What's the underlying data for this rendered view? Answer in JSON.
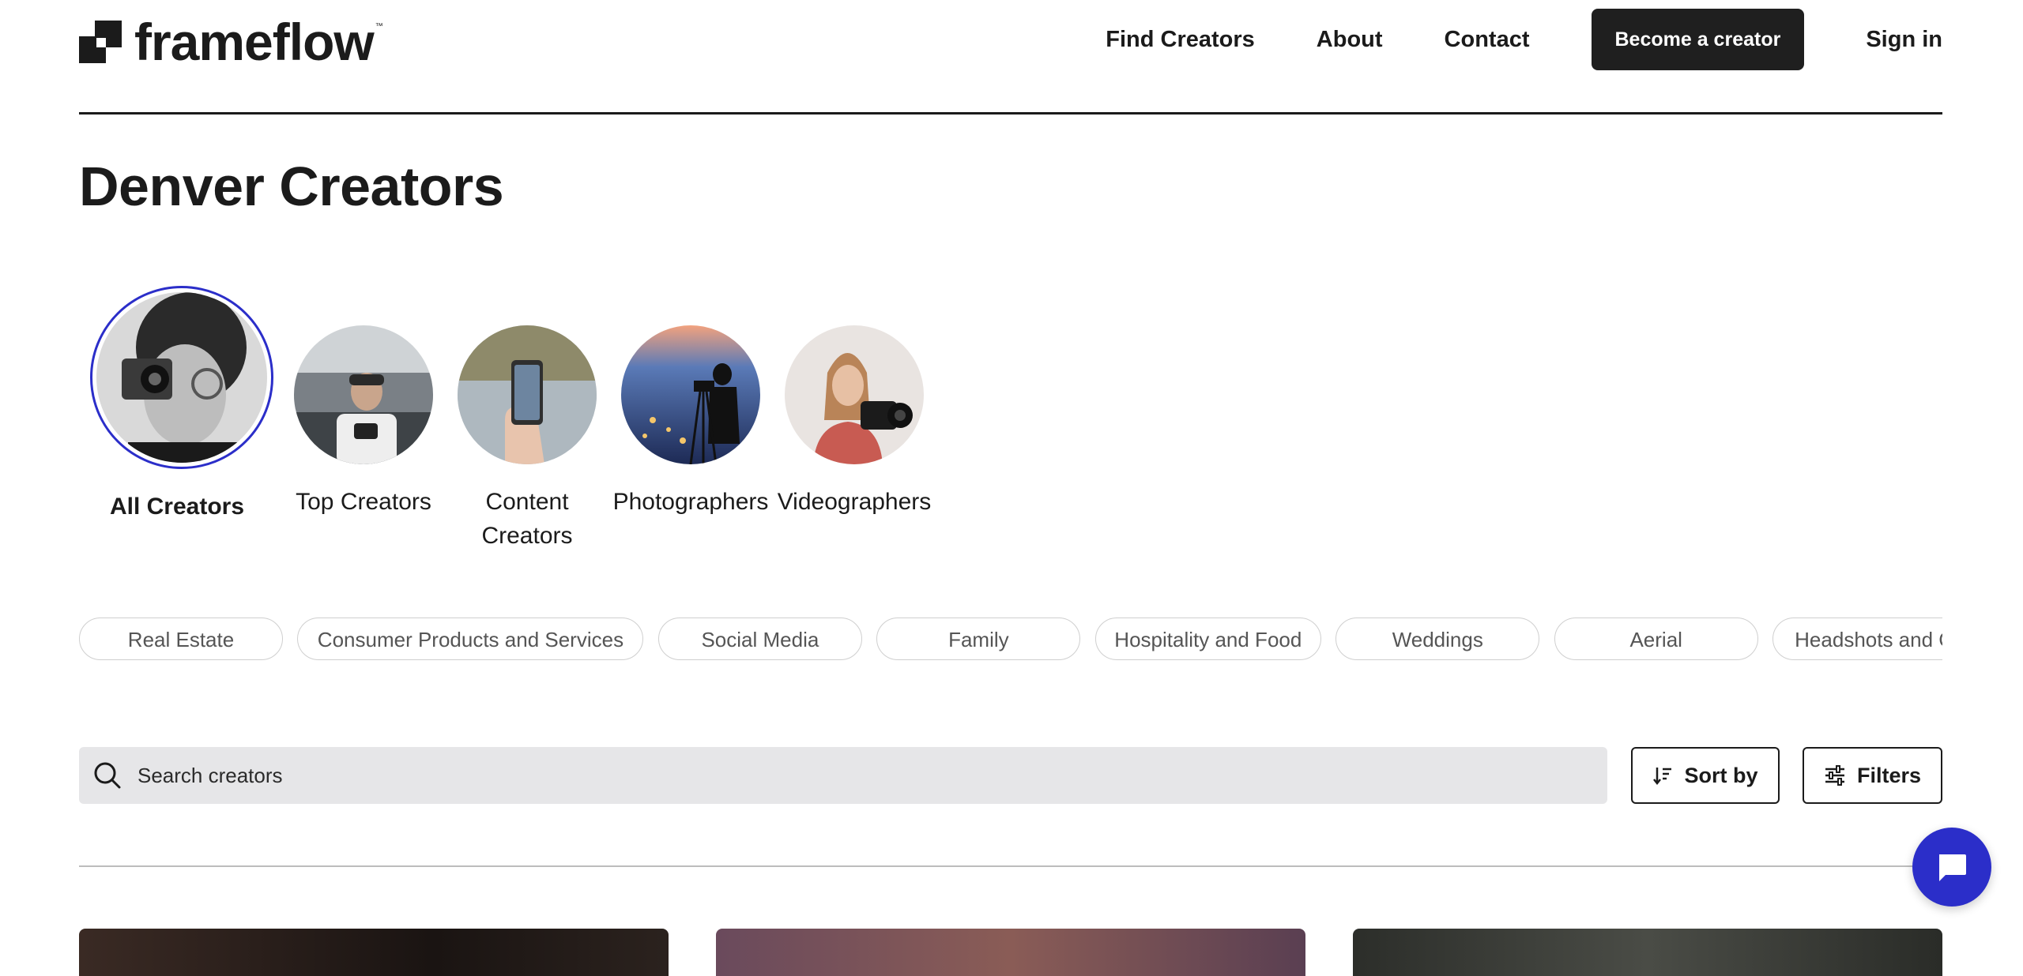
{
  "header": {
    "logo_text": "frameflow",
    "logo_tm": "™",
    "nav": {
      "find_creators": "Find Creators",
      "about": "About",
      "contact": "Contact",
      "become_creator": "Become a creator",
      "sign_in": "Sign in"
    }
  },
  "page": {
    "title": "Denver Creators"
  },
  "categories": [
    {
      "label": "All Creators",
      "active": true
    },
    {
      "label": "Top Creators",
      "active": false
    },
    {
      "label": "Content Creators",
      "active": false
    },
    {
      "label": "Photographers",
      "active": false
    },
    {
      "label": "Videographers",
      "active": false
    }
  ],
  "pills": [
    "Real Estate",
    "Consumer Products and Services",
    "Social Media",
    "Family",
    "Hospitality and Food",
    "Weddings",
    "Aerial",
    "Headshots and Cor"
  ],
  "search": {
    "placeholder": "Search creators"
  },
  "controls": {
    "sort_label": "Sort by",
    "filters_label": "Filters"
  },
  "colors": {
    "accent": "#2b2ec9",
    "dark_button": "#1f1f1f",
    "search_bg": "#e6e6e8"
  },
  "icons": [
    "search-icon",
    "sort-icon",
    "filters-icon",
    "chat-icon"
  ]
}
